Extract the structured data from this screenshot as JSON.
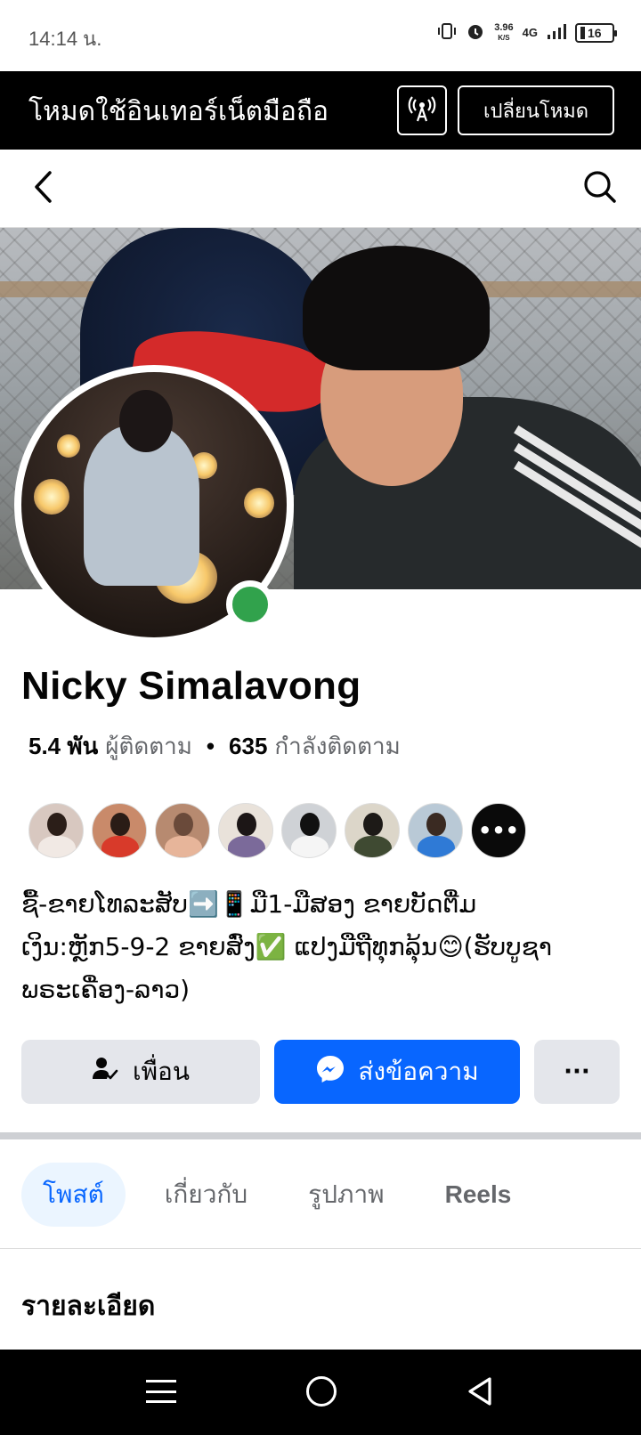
{
  "status_bar": {
    "time": "14:14 น.",
    "speed_value": "3.96",
    "speed_unit": "K/S",
    "network": "4G",
    "battery": "16"
  },
  "data_mode_banner": {
    "text": "โหมดใช้อินเทอร์เน็ตมือถือ",
    "switch_label": "เปลี่ยนโหมด"
  },
  "profile": {
    "name": "Nicky Simalavong",
    "followers_count": "5.4 พัน",
    "followers_label": "ผู้ติดตาม",
    "following_count": "635",
    "following_label": "กำลังติดตาม",
    "online": true,
    "bio_line1": "ຊື້-ຂາຍໂທລະສັບ➡️📱ມື1-ມືສອງ ຂາຍບັດຕື່ມ",
    "bio_line2": "ເງິນ:ຫຼັກ5-9-2 ຂາຍສົ່ງ✅ ແປງມືຖືທຸກລຸ້ນ😊(ຮັບບູຊາ",
    "bio_line3": "ພຣະເຄື່ອງ-ລາວ)"
  },
  "actions": {
    "friend_label": "เพื่อน",
    "message_label": "ส่งข้อความ",
    "more_label": "···"
  },
  "tabs": [
    {
      "label": "โพสต์",
      "active": true
    },
    {
      "label": "เกี่ยวกับ",
      "active": false
    },
    {
      "label": "รูปภาพ",
      "active": false
    },
    {
      "label": "Reels",
      "active": false
    }
  ],
  "section": {
    "details_title": "รายละเอียด"
  },
  "colors": {
    "accent": "#0866ff",
    "online": "#31a24c",
    "secondary_button": "#e4e6eb"
  },
  "icons": {
    "back": "chevron-left-icon",
    "search": "search-icon",
    "hotspot": "broadcast-icon",
    "friend": "friend-check-icon",
    "messenger": "messenger-icon"
  }
}
